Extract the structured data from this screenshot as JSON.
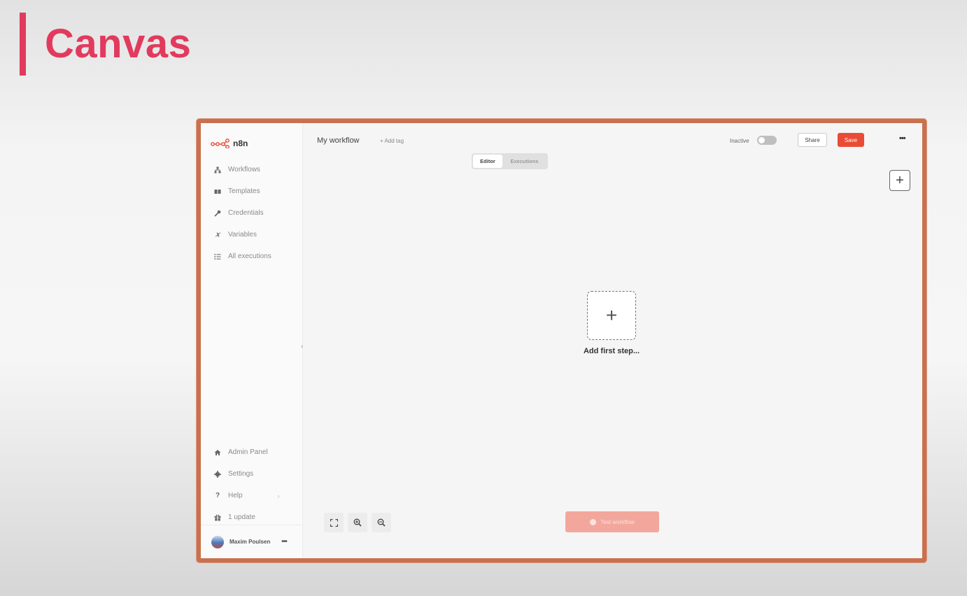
{
  "slide": {
    "title": "Canvas"
  },
  "app": {
    "logo_text": "n8n",
    "accent": "#ea4b35"
  },
  "sidebar": {
    "items": [
      {
        "label": "Workflows",
        "icon": "network-icon"
      },
      {
        "label": "Templates",
        "icon": "boxes-icon"
      },
      {
        "label": "Credentials",
        "icon": "key-icon"
      },
      {
        "label": "Variables",
        "icon": "variable-x-icon"
      },
      {
        "label": "All executions",
        "icon": "list-icon"
      }
    ],
    "bottom_items": [
      {
        "label": "Admin Panel",
        "icon": "home-icon"
      },
      {
        "label": "Settings",
        "icon": "gear-icon"
      },
      {
        "label": "Help",
        "icon": "question-icon"
      },
      {
        "label": "1 update",
        "icon": "gift-icon"
      }
    ],
    "user": {
      "name": "Maxim Poulsen",
      "more": "•••"
    }
  },
  "topbar": {
    "workflow_name": "My workflow",
    "add_tag": "+ Add tag",
    "status": "Inactive",
    "share": "Share",
    "save": "Save",
    "more": "•••"
  },
  "tabs": {
    "editor": "Editor",
    "executions": "Executions"
  },
  "canvas": {
    "add_first_step": "Add first step...",
    "execute_label": "Test workflow"
  }
}
